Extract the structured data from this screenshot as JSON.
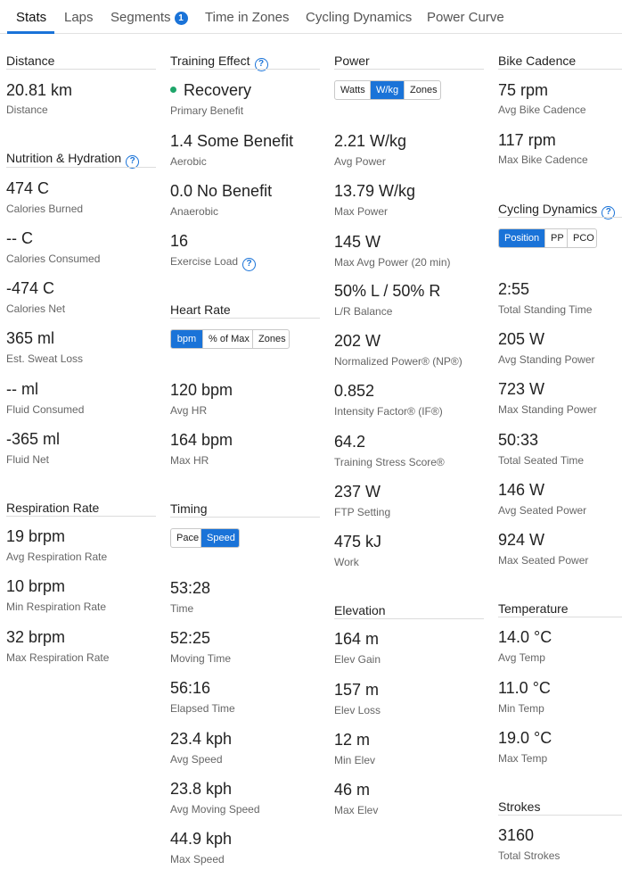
{
  "tabs": {
    "stats": "Stats",
    "laps": "Laps",
    "segments": "Segments",
    "segments_badge": "1",
    "time_in_zones": "Time in Zones",
    "cycling_dynamics": "Cycling Dynamics",
    "power_curve": "Power Curve"
  },
  "icons": {
    "help": "question-circle-icon",
    "help_glyph": "?"
  },
  "colors": {
    "accent": "#1a73d8",
    "recovery_dot": "#1ea56a"
  },
  "distance": {
    "title": "Distance",
    "value": "20.81 km",
    "label": "Distance"
  },
  "nutrition": {
    "title": "Nutrition & Hydration",
    "calories_burned": {
      "value": "474 C",
      "label": "Calories Burned"
    },
    "calories_consumed": {
      "value": "-- C",
      "label": "Calories Consumed"
    },
    "calories_net": {
      "value": "-474 C",
      "label": "Calories Net"
    },
    "sweat_loss": {
      "value": "365 ml",
      "label": "Est. Sweat Loss"
    },
    "fluid_consumed": {
      "value": "-- ml",
      "label": "Fluid Consumed"
    },
    "fluid_net": {
      "value": "-365 ml",
      "label": "Fluid Net"
    }
  },
  "respiration": {
    "title": "Respiration Rate",
    "avg": {
      "value": "19 brpm",
      "label": "Avg Respiration Rate"
    },
    "min": {
      "value": "10 brpm",
      "label": "Min Respiration Rate"
    },
    "max": {
      "value": "32 brpm",
      "label": "Max Respiration Rate"
    }
  },
  "training_effect": {
    "title": "Training Effect",
    "primary": {
      "value": "Recovery",
      "label": "Primary Benefit"
    },
    "aerobic": {
      "value": "1.4 Some Benefit",
      "label": "Aerobic"
    },
    "anaerobic": {
      "value": "0.0 No Benefit",
      "label": "Anaerobic"
    },
    "exercise_load": {
      "value": "16",
      "label": "Exercise Load"
    }
  },
  "heart_rate": {
    "title": "Heart Rate",
    "toggle": [
      "bpm",
      "% of Max",
      "Zones"
    ],
    "avg": {
      "value": "120 bpm",
      "label": "Avg HR"
    },
    "max": {
      "value": "164 bpm",
      "label": "Max HR"
    }
  },
  "timing": {
    "title": "Timing",
    "toggle": [
      "Pace",
      "Speed"
    ],
    "time": {
      "value": "53:28",
      "label": "Time"
    },
    "moving_time": {
      "value": "52:25",
      "label": "Moving Time"
    },
    "elapsed_time": {
      "value": "56:16",
      "label": "Elapsed Time"
    },
    "avg_speed": {
      "value": "23.4 kph",
      "label": "Avg Speed"
    },
    "avg_moving_speed": {
      "value": "23.8 kph",
      "label": "Avg Moving Speed"
    },
    "max_speed": {
      "value": "44.9 kph",
      "label": "Max Speed"
    }
  },
  "power": {
    "title": "Power",
    "toggle": [
      "Watts",
      "W/kg",
      "Zones"
    ],
    "avg_power": {
      "value": "2.21 W/kg",
      "label": "Avg Power"
    },
    "max_power": {
      "value": "13.79 W/kg",
      "label": "Max Power"
    },
    "max_avg_power": {
      "value": "145 W",
      "label": "Max Avg Power (20 min)"
    },
    "lr_balance": {
      "value": "50% L / 50% R",
      "label": "L/R Balance"
    },
    "np": {
      "value": "202 W",
      "label": "Normalized Power® (NP®)"
    },
    "if": {
      "value": "0.852",
      "label": "Intensity Factor® (IF®)"
    },
    "tss": {
      "value": "64.2",
      "label": "Training Stress Score®"
    },
    "ftp": {
      "value": "237 W",
      "label": "FTP Setting"
    },
    "work": {
      "value": "475 kJ",
      "label": "Work"
    }
  },
  "elevation": {
    "title": "Elevation",
    "gain": {
      "value": "164 m",
      "label": "Elev Gain"
    },
    "loss": {
      "value": "157 m",
      "label": "Elev Loss"
    },
    "min": {
      "value": "12 m",
      "label": "Min Elev"
    },
    "max": {
      "value": "46 m",
      "label": "Max Elev"
    }
  },
  "cadence": {
    "title": "Bike Cadence",
    "avg": {
      "value": "75 rpm",
      "label": "Avg Bike Cadence"
    },
    "max": {
      "value": "117 rpm",
      "label": "Max Bike Cadence"
    }
  },
  "cycling_dynamics": {
    "title": "Cycling Dynamics",
    "toggle": [
      "Position",
      "PP",
      "PCO"
    ],
    "standing_time": {
      "value": "2:55",
      "label": "Total Standing Time"
    },
    "avg_standing_power": {
      "value": "205 W",
      "label": "Avg Standing Power"
    },
    "max_standing_power": {
      "value": "723 W",
      "label": "Max Standing Power"
    },
    "seated_time": {
      "value": "50:33",
      "label": "Total Seated Time"
    },
    "avg_seated_power": {
      "value": "146 W",
      "label": "Avg Seated Power"
    },
    "max_seated_power": {
      "value": "924 W",
      "label": "Max Seated Power"
    }
  },
  "temperature": {
    "title": "Temperature",
    "avg": {
      "value": "14.0 °C",
      "label": "Avg Temp"
    },
    "min": {
      "value": "11.0 °C",
      "label": "Min Temp"
    },
    "max": {
      "value": "19.0 °C",
      "label": "Max Temp"
    }
  },
  "strokes": {
    "title": "Strokes",
    "total": {
      "value": "3160",
      "label": "Total Strokes"
    }
  }
}
